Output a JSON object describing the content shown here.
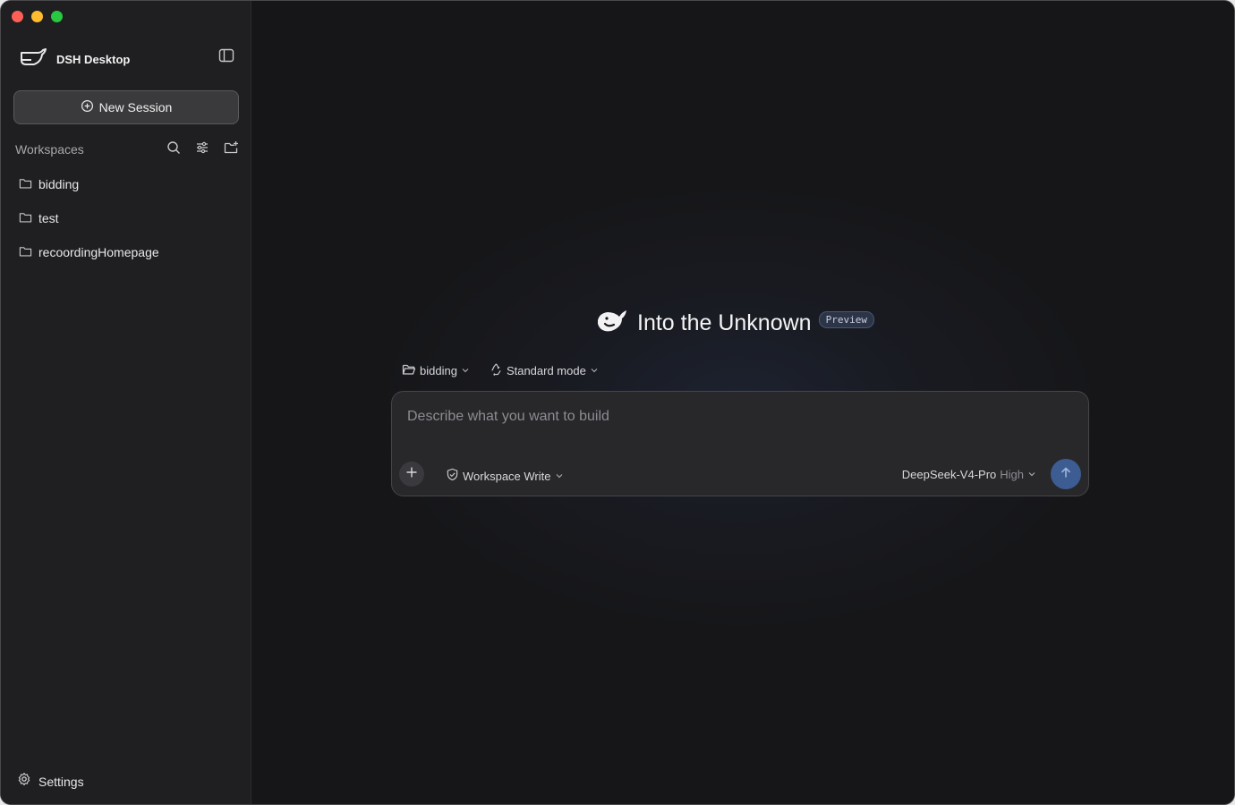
{
  "sidebar": {
    "brand": "DSH Desktop",
    "new_session_label": "New Session",
    "workspaces_title": "Workspaces",
    "workspaces": [
      {
        "label": "bidding"
      },
      {
        "label": "test"
      },
      {
        "label": "recoordingHomepage"
      }
    ],
    "settings_label": "Settings"
  },
  "hero": {
    "title": "Into the Unknown",
    "badge": "Preview"
  },
  "selectors": {
    "workspace": "bidding",
    "mode": "Standard mode"
  },
  "composer": {
    "placeholder": "Describe what you want to build",
    "value": "",
    "permission": "Workspace Write",
    "model": "DeepSeek-V4-Pro",
    "level": "High"
  },
  "colors": {
    "accent": "#3d5c92",
    "sidebar_bg": "#1f1f21",
    "main_bg": "#161618"
  },
  "icons": {
    "brand": "whale-logo-icon",
    "toggle": "sidebar-toggle-icon",
    "new_session": "plus-circle-icon",
    "search": "search-icon",
    "filter": "sliders-icon",
    "new_folder": "folder-plus-icon",
    "folder": "folder-icon",
    "settings": "gear-icon",
    "mode": "recycle-icon",
    "permission": "shield-check-icon",
    "chevron": "chevron-down-icon",
    "plus": "plus-icon",
    "send": "arrow-up-icon"
  }
}
